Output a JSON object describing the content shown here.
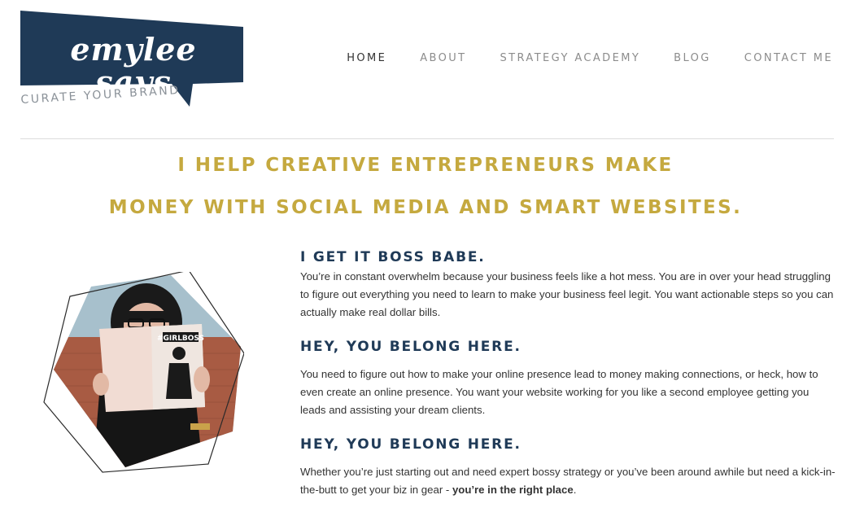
{
  "brand": {
    "logo_text": "emylee says",
    "tagline": "CURATE YOUR BRAND",
    "colors": {
      "navy": "#1f3a57",
      "gold": "#c5a93f"
    }
  },
  "nav": {
    "items": [
      {
        "label": "HOME",
        "active": true
      },
      {
        "label": "ABOUT"
      },
      {
        "label": "STRATEGY ACADEMY"
      },
      {
        "label": "BLOG"
      },
      {
        "label": "CONTACT ME"
      }
    ]
  },
  "hero": {
    "line1": "I HELP CREATIVE ENTREPRENEURS MAKE",
    "line2": "MONEY WITH SOCIAL MEDIA AND SMART WEBSITES."
  },
  "photo": {
    "book_title": "#GIRLBOSS"
  },
  "sections": [
    {
      "title": "I GET IT BOSS BABE.",
      "text": "You’re in constant overwhelm because your business feels like a hot mess. You are in over your head struggling to figure out everything you need to learn to make your business feel legit. You want actionable steps so you can actually make real dollar bills."
    },
    {
      "title": "HEY, YOU BELONG HERE.",
      "text": "You need to figure out how to make your online presence lead to money making connections, or heck, how to even create an online presence. You want your website working for you like a second employee getting you leads and assisting your dream clients."
    },
    {
      "title": "HEY, YOU BELONG HERE.",
      "text_before": "Whether you’re just starting out and need expert bossy strategy or you’ve been around awhile but need a kick-in-the-butt to get your biz in gear - ",
      "text_bold": "you’re in the right place",
      "text_after": "."
    }
  ]
}
